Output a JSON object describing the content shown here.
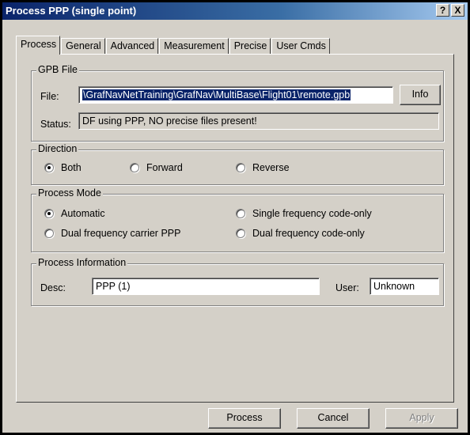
{
  "window": {
    "title": "Process PPP (single point)",
    "help_label": "?",
    "close_label": "X"
  },
  "tabs": [
    {
      "label": "Process",
      "active": true
    },
    {
      "label": "General"
    },
    {
      "label": "Advanced"
    },
    {
      "label": "Measurement"
    },
    {
      "label": "Precise"
    },
    {
      "label": "User Cmds"
    }
  ],
  "gpb_file": {
    "legend": "GPB File",
    "file_label": "File:",
    "file_value": "\\GrafNavNetTraining\\GrafNav\\MultiBase\\Flight01\\remote.gpb",
    "info_label": "Info",
    "status_label": "Status:",
    "status_value": "DF using PPP, NO precise files present!"
  },
  "direction": {
    "legend": "Direction",
    "options": [
      "Both",
      "Forward",
      "Reverse"
    ],
    "selected": "Both"
  },
  "process_mode": {
    "legend": "Process Mode",
    "options": [
      "Automatic",
      "Single frequency code-only",
      "Dual frequency carrier PPP",
      "Dual frequency code-only"
    ],
    "selected": "Automatic"
  },
  "process_info": {
    "legend": "Process Information",
    "desc_label": "Desc:",
    "desc_value": "PPP (1)",
    "user_label": "User:",
    "user_value": "Unknown"
  },
  "footer": {
    "process_label": "Process",
    "cancel_label": "Cancel",
    "apply_label": "Apply"
  }
}
